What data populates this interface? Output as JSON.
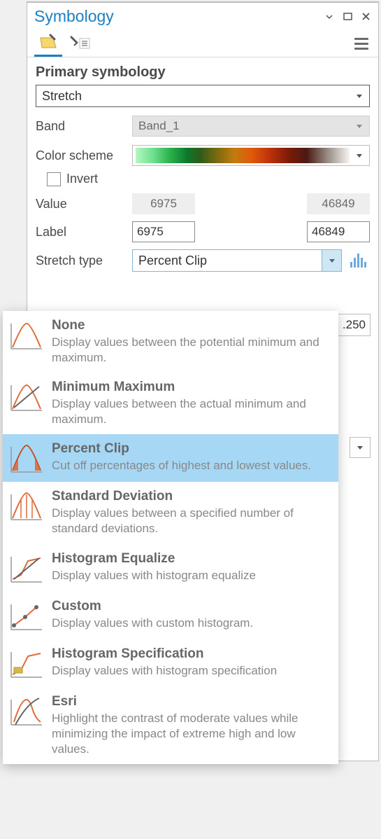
{
  "pane": {
    "title": "Symbology"
  },
  "section": {
    "primary_title": "Primary symbology",
    "symbology_type": "Stretch"
  },
  "fields": {
    "band_label": "Band",
    "band_value": "Band_1",
    "color_scheme_label": "Color scheme",
    "invert_label": "Invert",
    "value_label": "Value",
    "value_min": "6975",
    "value_max": "46849",
    "label_label": "Label",
    "label_min": "6975",
    "label_max": "46849",
    "stretch_type_label": "Stretch type",
    "stretch_type_value": "Percent Clip",
    "peek_value": ".250"
  },
  "stretch_dropdown": {
    "options": [
      {
        "title": "None",
        "desc": "Display values between the potential minimum and maximum.",
        "selected": false
      },
      {
        "title": "Minimum Maximum",
        "desc": "Display values between the actual minimum and maximum.",
        "selected": false
      },
      {
        "title": "Percent Clip",
        "desc": "Cut off percentages of highest and lowest values.",
        "selected": true
      },
      {
        "title": "Standard Deviation",
        "desc": "Display values between a specified number of standard deviations.",
        "selected": false
      },
      {
        "title": "Histogram Equalize",
        "desc": "Display values with histogram equalize",
        "selected": false
      },
      {
        "title": "Custom",
        "desc": "Display values with custom histogram.",
        "selected": false
      },
      {
        "title": "Histogram Specification",
        "desc": "Display values with histogram specification",
        "selected": false
      },
      {
        "title": "Esri",
        "desc": "Highlight the contrast of moderate values while minimizing the impact of extreme high and low values.",
        "selected": false
      }
    ]
  }
}
